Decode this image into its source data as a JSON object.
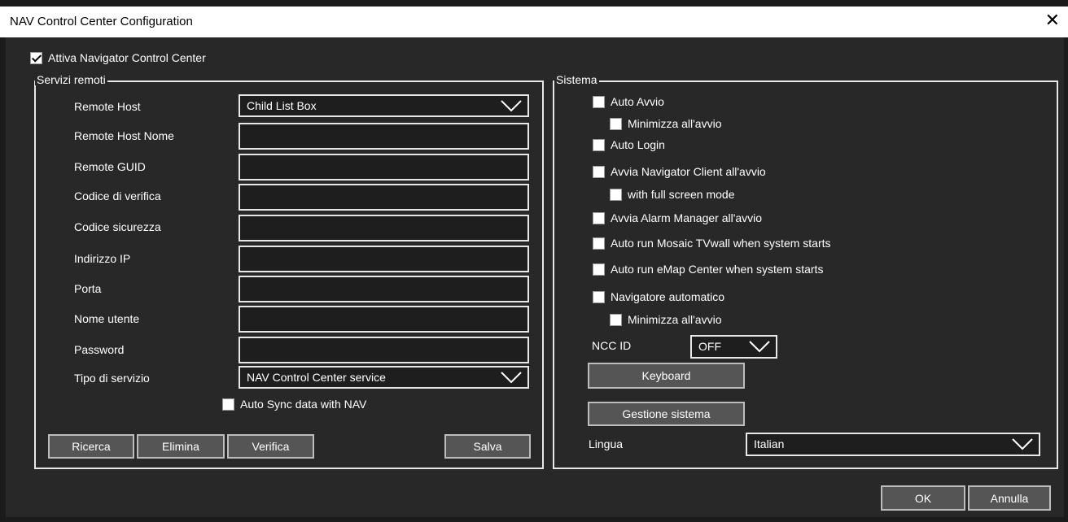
{
  "window": {
    "title": "NAV Control Center Configuration"
  },
  "enable": {
    "label": "Attiva Navigator Control Center",
    "checked": true
  },
  "remote": {
    "legend": "Servizi remoti",
    "host_label": "Remote Host",
    "host_value": "Child List Box",
    "host_name_label": "Remote Host Nome",
    "guid_label": "Remote GUID",
    "verify_code_label": "Codice di verifica",
    "security_code_label": "Codice sicurezza",
    "ip_label": "Indirizzo IP",
    "port_label": "Porta",
    "username_label": "Nome utente",
    "password_label": "Password",
    "service_type_label": "Tipo di servizio",
    "service_type_value": "NAV Control Center service",
    "auto_sync_label": "Auto Sync data with NAV",
    "search_button": "Ricerca",
    "delete_button": "Elimina",
    "verify_button": "Verifica",
    "save_button": "Salva"
  },
  "system": {
    "legend": "Sistema",
    "auto_start": "Auto Avvio",
    "minimize_on_start": "Minimizza all'avvio",
    "auto_login": "Auto Login",
    "start_client": "Avvia Navigator Client all'avvio",
    "full_screen": "with full screen mode",
    "start_alarm": "Avvia Alarm Manager all'avvio",
    "start_mosaic": "Auto run Mosaic TVwall when system starts",
    "start_emap": "Auto run eMap Center when system starts",
    "auto_navigator": "Navigatore automatico",
    "minimize_on_start_2": "Minimizza all'avvio",
    "ncc_id_label": "NCC ID",
    "ncc_id_value": "OFF",
    "keyboard_button": "Keyboard",
    "manage_button": "Gestione sistema",
    "language_label": "Lingua",
    "language_value": "Italian"
  },
  "footer": {
    "ok": "OK",
    "cancel": "Annulla"
  }
}
